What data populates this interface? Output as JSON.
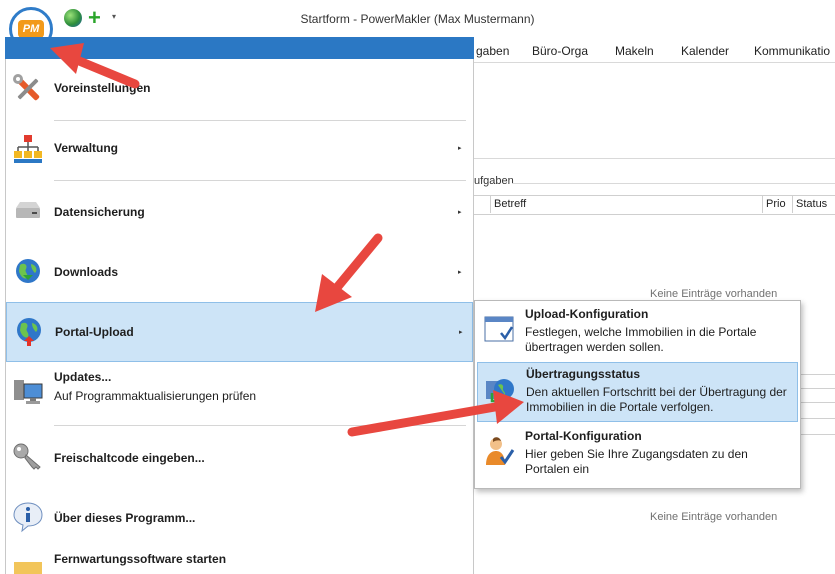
{
  "window": {
    "title": "Startform - PowerMakler (Max Mustermann)",
    "app_logo_text": "PM"
  },
  "quick_access": {
    "globe_icon": "globe-icon",
    "plus_icon": "plus-icon",
    "dropdown_glyph": "▾"
  },
  "ribbon": {
    "tabs": [
      "gaben",
      "Büro-Orga",
      "Makeln",
      "Kalender",
      "Kommunikatio"
    ]
  },
  "background": {
    "section_label": "ufgaben",
    "columns": [
      "Betreff",
      "Prio",
      "Status"
    ],
    "empty_top": "Keine Einträge vorhanden",
    "empty_bottom": "Keine Einträge vorhanden"
  },
  "app_menu": {
    "items": [
      {
        "label": "Voreinstellungen",
        "icon": "tools-icon"
      },
      {
        "label": "Verwaltung",
        "icon": "hierarchy-icon",
        "submenu": "▸"
      },
      {
        "label": "Datensicherung",
        "icon": "drive-icon",
        "submenu": "▸"
      },
      {
        "label": "Downloads",
        "icon": "globe-download-icon",
        "submenu": "▸"
      },
      {
        "label": "Portal-Upload",
        "icon": "globe-upload-icon",
        "submenu": "▸"
      },
      {
        "label": "Updates...",
        "desc": "Auf Programmaktualisierungen prüfen",
        "icon": "computer-update-icon"
      },
      {
        "label": "Freischaltcode eingeben...",
        "icon": "key-icon"
      },
      {
        "label": "Über dieses Programm...",
        "icon": "info-icon"
      },
      {
        "label": "Fernwartungssoftware starten",
        "icon": "remote-icon"
      }
    ]
  },
  "submenu": {
    "items": [
      {
        "title": "Upload-Konfiguration",
        "desc": "Festlegen, welche Immobilien in die Portale übertragen werden sollen.",
        "icon": "window-check-icon"
      },
      {
        "title": "Übertragungsstatus",
        "desc": "Den aktuellen Fortschritt bei der Übertragung der Immobilien in die Portale verfolgen.",
        "icon": "transfer-status-icon"
      },
      {
        "title": "Portal-Konfiguration",
        "desc": "Hier geben Sie Ihre Zugangsdaten zu den Portalen ein",
        "icon": "user-check-icon"
      }
    ]
  },
  "colors": {
    "menu_header": "#2b78c4",
    "highlight": "#cde4f7",
    "highlight_border": "#8fbfe8",
    "annotation_arrow": "#e8473f"
  }
}
